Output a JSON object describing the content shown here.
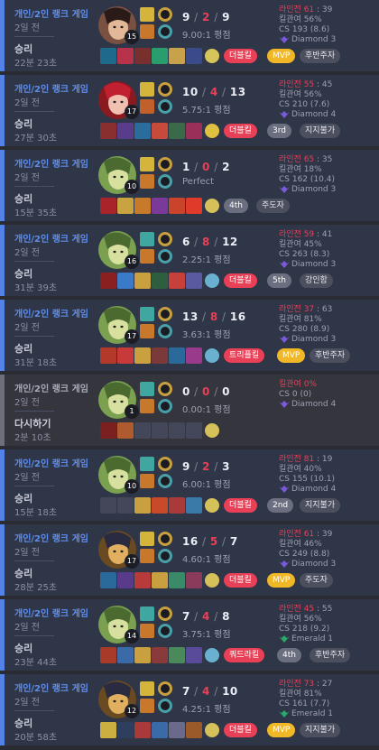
{
  "colors": {
    "win": "#5383e8",
    "remake": "#6e6f7a",
    "death": "#e84057",
    "mvp": "#f0b827"
  },
  "matches": [
    {
      "queue": "개인/2인 랭크 게임",
      "ago": "2일 전",
      "result": "승리",
      "duration": "22분 23초",
      "level": "15",
      "kills": "9",
      "deaths": "2",
      "assists": "9",
      "ratio": "9.00:1 평점",
      "champion_icon": "female-champion-portrait-icon",
      "remake": false,
      "tags": [
        "더블킬",
        "MVP",
        "후반주자"
      ],
      "lane_label": "라인전 61",
      "lane_score": " : 39",
      "kp": "킬관여 56%",
      "cs": "CS 193 (8.6)",
      "tier": "Diamond 3"
    },
    {
      "queue": "개인/2인 랭크 게임",
      "ago": "2일 전",
      "result": "승리",
      "duration": "27분 30초",
      "level": "17",
      "kills": "10",
      "deaths": "4",
      "assists": "13",
      "ratio": "5.75:1 평점",
      "champion_icon": "red-haired-champion-portrait-icon",
      "remake": false,
      "tags": [
        "더블킬",
        "3rd",
        "지지불가"
      ],
      "lane_label": "라인전 55",
      "lane_score": " : 45",
      "kp": "킬관여 56%",
      "cs": "CS 210 (7.6)",
      "tier": "Diamond 4"
    },
    {
      "queue": "개인/2인 랭크 게임",
      "ago": "2일 전",
      "result": "승리",
      "duration": "15분 35초",
      "level": "10",
      "kills": "1",
      "deaths": "0",
      "assists": "2",
      "ratio": "Perfect",
      "champion_icon": "green-champion-portrait-icon",
      "remake": false,
      "tags": [
        "4th",
        "주도자"
      ],
      "lane_label": "라인전 65",
      "lane_score": " : 35",
      "kp": "킬관여 18%",
      "cs": "CS 162 (10.4)",
      "tier": "Diamond 3"
    },
    {
      "queue": "개인/2인 랭크 게임",
      "ago": "2일 전",
      "result": "승리",
      "duration": "31분 39초",
      "level": "16",
      "kills": "6",
      "deaths": "8",
      "assists": "12",
      "ratio": "2.25:1 평점",
      "champion_icon": "green-champion-portrait-icon",
      "remake": false,
      "tags": [
        "더블킬",
        "5th",
        "강인함"
      ],
      "lane_label": "라인전 59",
      "lane_score": " : 41",
      "kp": "킬관여 45%",
      "cs": "CS 263 (8.3)",
      "tier": "Diamond 3"
    },
    {
      "queue": "개인/2인 랭크 게임",
      "ago": "2일 전",
      "result": "승리",
      "duration": "31분 18초",
      "level": "17",
      "kills": "13",
      "deaths": "8",
      "assists": "16",
      "ratio": "3.63:1 평점",
      "champion_icon": "green-champion-portrait-icon",
      "remake": false,
      "tags": [
        "트리플킬",
        "MVP",
        "후반주자"
      ],
      "lane_label": "라인전 37",
      "lane_score": " : 63",
      "kp": "킬관여 81%",
      "cs": "CS 280 (8.9)",
      "tier": "Diamond 3"
    },
    {
      "queue": "개인/2인 랭크 게임",
      "ago": "2일 전",
      "result": "다시하기",
      "duration": "2분 10초",
      "level": "1",
      "kills": "0",
      "deaths": "0",
      "assists": "0",
      "ratio": "0.00:1 평점",
      "champion_icon": "green-champion-portrait-icon",
      "remake": true,
      "tags": [],
      "lane_label": "킬관여 0%",
      "lane_score": "",
      "kp": "CS 0 (0)",
      "cs": "",
      "tier": "Diamond 4"
    },
    {
      "queue": "개인/2인 랭크 게임",
      "ago": "2일 전",
      "result": "승리",
      "duration": "15분 18초",
      "level": "10",
      "kills": "9",
      "deaths": "2",
      "assists": "3",
      "ratio": "6.00:1 평점",
      "champion_icon": "green-champion-portrait-icon",
      "remake": false,
      "tags": [
        "더블킬",
        "2nd",
        "지지불가"
      ],
      "lane_label": "라인전 81",
      "lane_score": " : 19",
      "kp": "킬관여 40%",
      "cs": "CS 155 (10.1)",
      "tier": "Diamond 4"
    },
    {
      "queue": "개인/2인 랭크 게임",
      "ago": "2일 전",
      "result": "승리",
      "duration": "28분 25초",
      "level": "17",
      "kills": "16",
      "deaths": "5",
      "assists": "7",
      "ratio": "4.60:1 평점",
      "champion_icon": "golden-champion-portrait-icon",
      "remake": false,
      "tags": [
        "더블킬",
        "MVP",
        "주도자"
      ],
      "lane_label": "라인전 61",
      "lane_score": " : 39",
      "kp": "킬관여 46%",
      "cs": "CS 249 (8.8)",
      "tier": "Diamond 3"
    },
    {
      "queue": "개인/2인 랭크 게임",
      "ago": "2일 전",
      "result": "승리",
      "duration": "23분 44초",
      "level": "14",
      "kills": "7",
      "deaths": "4",
      "assists": "8",
      "ratio": "3.75:1 평점",
      "champion_icon": "green-champion-portrait-icon",
      "remake": false,
      "tags": [
        "쿼드라킬",
        "4th",
        "후반주자"
      ],
      "lane_label": "라인전 45",
      "lane_score": " : 55",
      "kp": "킬관여 56%",
      "cs": "CS 218 (9.2)",
      "tier": "Emerald 1"
    },
    {
      "queue": "개인/2인 랭크 게임",
      "ago": "2일 전",
      "result": "승리",
      "duration": "20분 58초",
      "level": "12",
      "kills": "7",
      "deaths": "4",
      "assists": "10",
      "ratio": "4.25:1 평점",
      "champion_icon": "golden-champion-portrait-icon",
      "remake": false,
      "tags": [
        "더블킬",
        "MVP",
        "지지불가"
      ],
      "lane_label": "라인전 73",
      "lane_score": " : 27",
      "kp": "킬관여 81%",
      "cs": "CS 161 (7.7)",
      "tier": "Emerald 1"
    }
  ]
}
